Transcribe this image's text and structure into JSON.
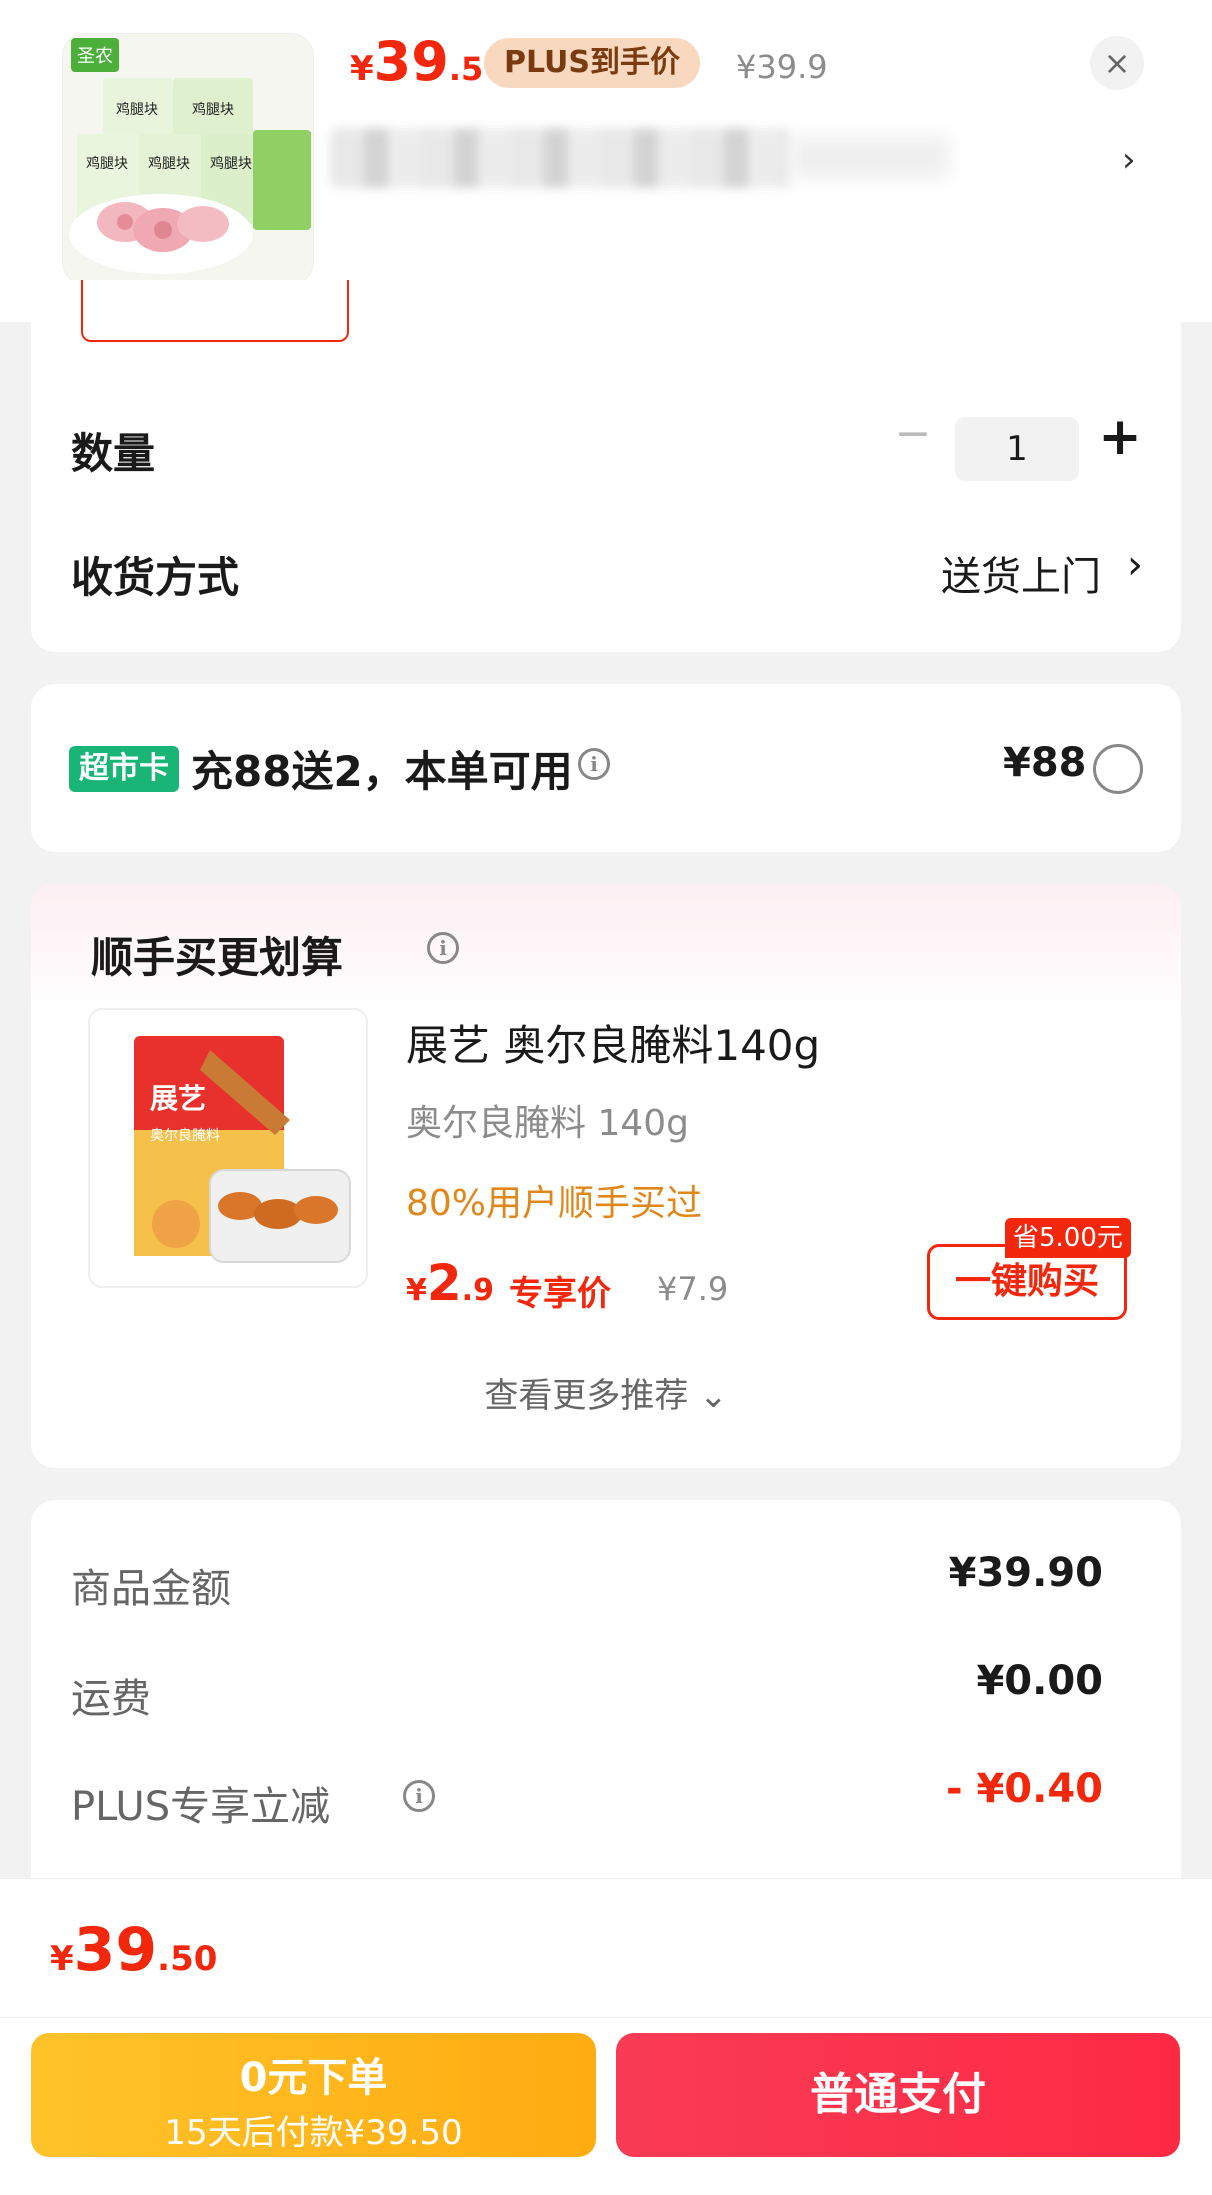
{
  "product": {
    "thumb_brand": "圣农",
    "thumb_label": "鸡腿块",
    "price_yen": "¥",
    "price_int": "39",
    "price_dec": ".5",
    "plus_tag": "PLUS到手价",
    "original_price": "¥39.9",
    "close_icon": "×",
    "spec_arrow": "›"
  },
  "quantity": {
    "label": "数量",
    "minus": "−",
    "value": "1",
    "plus": "+"
  },
  "delivery": {
    "label": "收货方式",
    "value": "送货上门",
    "arrow": "›"
  },
  "supermarket": {
    "badge": "超市卡",
    "text": "充88送2，本单可用",
    "info_icon": "i",
    "price": "¥88"
  },
  "recommend": {
    "title": "顺手买更划算",
    "info_icon": "i",
    "img_brand": "展艺",
    "img_text": "奥尔良腌料",
    "item_name": "展艺 奥尔良腌料140g",
    "item_spec": "奥尔良腌料 140g",
    "item_hint": "80%用户顺手买过",
    "price_yen": "¥",
    "price_int": "2",
    "price_dec": ".9",
    "price_label": "专享价",
    "original_price": "¥7.9",
    "save_badge": "省5.00元",
    "buy_button": "一键购买",
    "more_link": "查看更多推荐 ⌄"
  },
  "summary": {
    "rows": [
      {
        "label": "商品金额",
        "value": "¥39.90"
      },
      {
        "label": "运费",
        "value": "¥0.00"
      },
      {
        "label": "PLUS专享立减",
        "value": "- ¥0.40"
      }
    ],
    "info_icon": "i"
  },
  "footer": {
    "total_yen": "¥",
    "total_int": "39",
    "total_dec": ".50",
    "later_line1": "0元下单",
    "later_line2": "15天后付款¥39.50",
    "pay_button": "普通支付"
  },
  "colors": {
    "accent_red": "#f2270c",
    "green_badge": "#19b576",
    "gold": "#ffb41c",
    "hint_orange": "#e0871a"
  }
}
